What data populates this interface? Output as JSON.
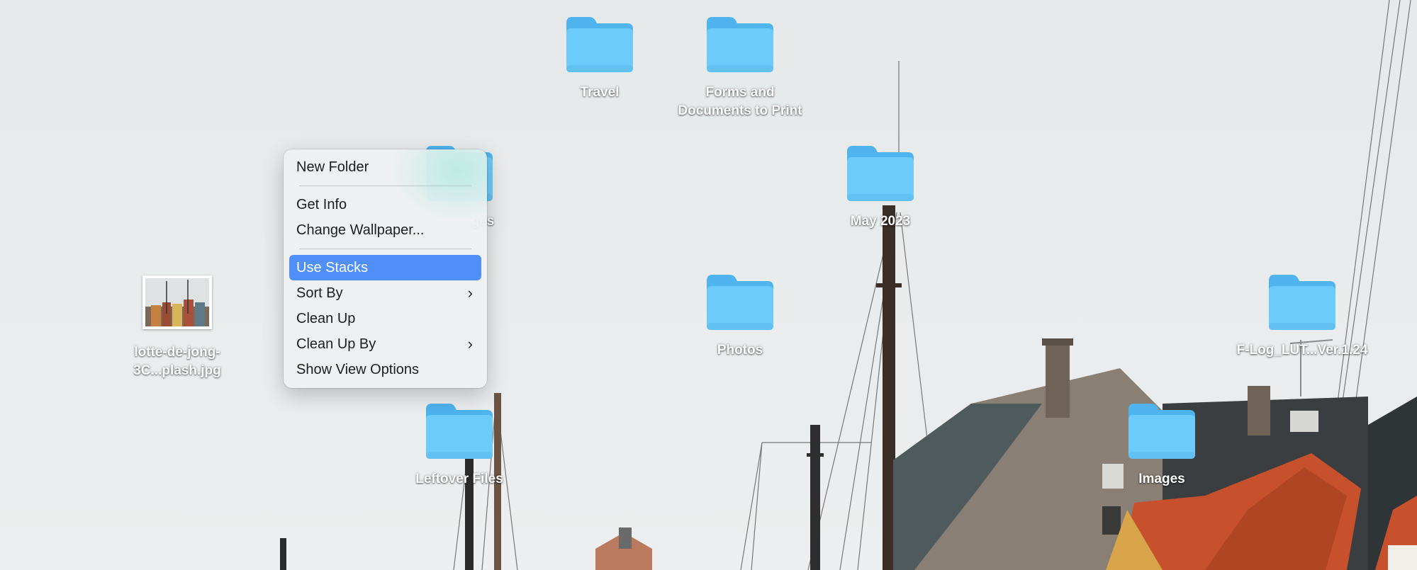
{
  "desktop": {
    "icons": [
      {
        "label": "Travel",
        "kind": "folder"
      },
      {
        "label": "Forms and Documents to Print",
        "kind": "folder"
      },
      {
        "label": "ges",
        "kind": "folder"
      },
      {
        "label": "May 2023",
        "kind": "folder"
      },
      {
        "label": "lotte-de-jong-3C...plash.jpg",
        "kind": "image-file"
      },
      {
        "label": "Photos",
        "kind": "folder"
      },
      {
        "label": "F-Log_LUT...Ver.1.24",
        "kind": "folder"
      },
      {
        "label": "Leftover Files",
        "kind": "folder"
      },
      {
        "label": "Images",
        "kind": "folder"
      }
    ]
  },
  "context_menu": {
    "items": [
      {
        "label": "New Folder"
      },
      {
        "label": "Get Info"
      },
      {
        "label": "Change Wallpaper..."
      },
      {
        "label": "Use Stacks",
        "highlighted": true
      },
      {
        "label": "Sort By",
        "submenu": true
      },
      {
        "label": "Clean Up"
      },
      {
        "label": "Clean Up By",
        "submenu": true
      },
      {
        "label": "Show View Options"
      }
    ],
    "submenu_glyph": "›"
  },
  "colors": {
    "folder_body": "#6ccbfa",
    "folder_tab": "#4fb3ee",
    "menu_highlight": "#4f8ff7",
    "sky": "#e9ebec"
  }
}
